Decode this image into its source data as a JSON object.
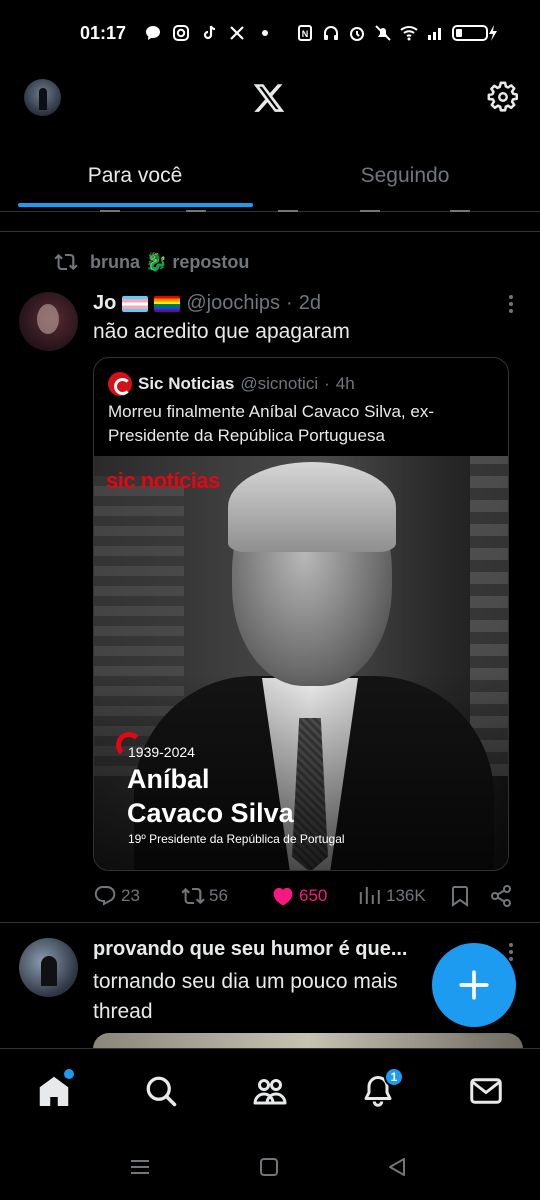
{
  "status_bar": {
    "time": "01:17",
    "left_icons": [
      "chat-bubble-icon",
      "instagram-icon",
      "tiktok-icon",
      "x-icon",
      "dot-icon"
    ],
    "right_icons": [
      "nfc-icon",
      "headset-icon",
      "alarm-icon",
      "mute-icon",
      "wifi-icon",
      "signal-icon",
      "battery-charging-icon"
    ]
  },
  "header": {
    "logo": "x-logo-icon",
    "settings_icon": "gear-icon"
  },
  "tabs": [
    {
      "label": "Para você",
      "active": true
    },
    {
      "label": "Seguindo",
      "active": false
    }
  ],
  "tweet": {
    "repost_by": "bruna 🐉 repostou",
    "author_name": "Jo",
    "handle": "@joochips",
    "dot": "·",
    "time": "2d",
    "text": "não acredito que apagaram",
    "quote": {
      "author_name": "Sic Noticias",
      "handle": "@sicnotici",
      "dot": "·",
      "time": "4h",
      "text": "Morreu finalmente Aníbal Cavaco Silva, ex-Presidente da República Portuguesa",
      "image": {
        "logo_text": "sic notícias",
        "years": "1939-2024",
        "name_line1": "Aníbal",
        "name_line2": "Cavaco Silva",
        "subtitle": "19º Presidente da República de Portugal"
      }
    },
    "actions": {
      "replies": "23",
      "reposts": "56",
      "likes": "650",
      "views": "136K"
    }
  },
  "tweet2": {
    "author_name": "provando que seu humor é que...",
    "text": "tornando seu dia um pouco mais\nthread"
  },
  "fab": {
    "icon": "plus-icon"
  },
  "bottom_nav": {
    "items": [
      "home-icon",
      "search-icon",
      "communities-icon",
      "notifications-icon",
      "messages-icon"
    ],
    "notification_count": "1"
  },
  "colors": {
    "accent": "#1d9bf0",
    "like": "#f91880",
    "muted": "#71767b",
    "text": "#e7e9ea",
    "border": "#2f3336",
    "sic_red": "#e30613"
  }
}
